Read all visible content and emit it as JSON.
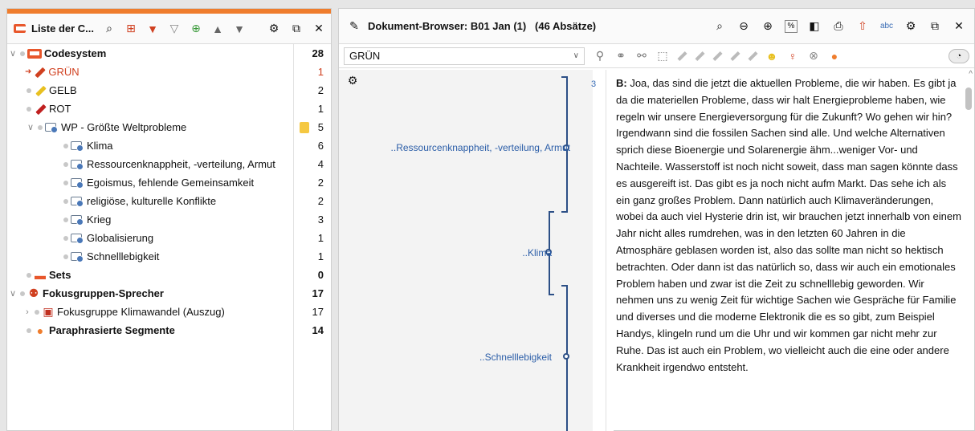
{
  "left_panel": {
    "title": "Liste der C...",
    "codes": [
      {
        "label": "Codesystem",
        "count": "28"
      },
      {
        "label": "GRÜN",
        "count": "1"
      },
      {
        "label": "GELB",
        "count": "2"
      },
      {
        "label": "ROT",
        "count": "1"
      },
      {
        "label": "WP - Größte Weltprobleme",
        "count": "5"
      },
      {
        "label": "Klima",
        "count": "6"
      },
      {
        "label": "Ressourcenknappheit, -verteilung, Armut",
        "count": "4"
      },
      {
        "label": "Egoismus, fehlende Gemeinsamkeit",
        "count": "2"
      },
      {
        "label": "religiöse, kulturelle Konflikte",
        "count": "2"
      },
      {
        "label": "Krieg",
        "count": "3"
      },
      {
        "label": "Globalisierung",
        "count": "1"
      },
      {
        "label": "Schnelllebigkeit",
        "count": "1"
      },
      {
        "label": "Sets",
        "count": "0"
      },
      {
        "label": "Fokusgruppen-Sprecher",
        "count": "17"
      },
      {
        "label": "Fokusgruppe Klimawandel (Auszug)",
        "count": "17"
      },
      {
        "label": "Paraphrasierte Segmente",
        "count": "14"
      }
    ]
  },
  "right_panel": {
    "title": "Dokument-Browser: B01 Jan (1)   (46 Absätze)",
    "code_select": "GRÜN",
    "paragraph_number": "3",
    "speaker": "B:",
    "text": " Joa, das sind die jetzt die aktuellen Probleme, die wir haben. Es gibt ja da die materiellen Probleme, dass wir halt Energieprobleme haben, wie regeln wir unsere Energieversorgung für die Zukunft? Wo gehen wir hin? Irgendwann sind die fossilen Sachen sind alle. Und welche Alternativen sprich diese Bioenergie und Solarenergie ähm...weniger Vor- und Nachteile. Wasserstoff ist noch nicht soweit, dass man sagen könnte dass es ausgereift ist. Das gibt es ja noch nicht aufm Markt. Das sehe ich als ein ganz großes Problem. Dann natürlich auch Klimaveränderungen, wobei da auch viel Hysterie drin ist, wir brauchen jetzt innerhalb von einem Jahr nicht alles rumdrehen, was in den letzten 60 Jahren in die Atmosphäre geblasen worden ist, also das sollte man nicht so hektisch betrachten. Oder dann ist das natürlich so, dass wir auch ein emotionales Problem haben und zwar ist die Zeit zu schnelllebig geworden. Wir nehmen uns zu wenig Zeit für wichtige Sachen wie Gespräche für Familie und diverses und die moderne Elektronik die es so gibt, zum Beispiel Handys, klingeln rund um die Uhr und wir kommen gar nicht mehr zur Ruhe. Das ist auch ein Problem, wo vielleicht auch die eine oder andere Krankheit irgendwo entsteht.",
    "segments": [
      "..Ressourcenknappheit, -verteilung, Armut",
      "..Klima",
      "..Schnelllebigkeit"
    ]
  },
  "colors": {
    "accent": "#ef7d2d",
    "segment_blue": "#2c4f86",
    "code_red": "#d04020"
  }
}
